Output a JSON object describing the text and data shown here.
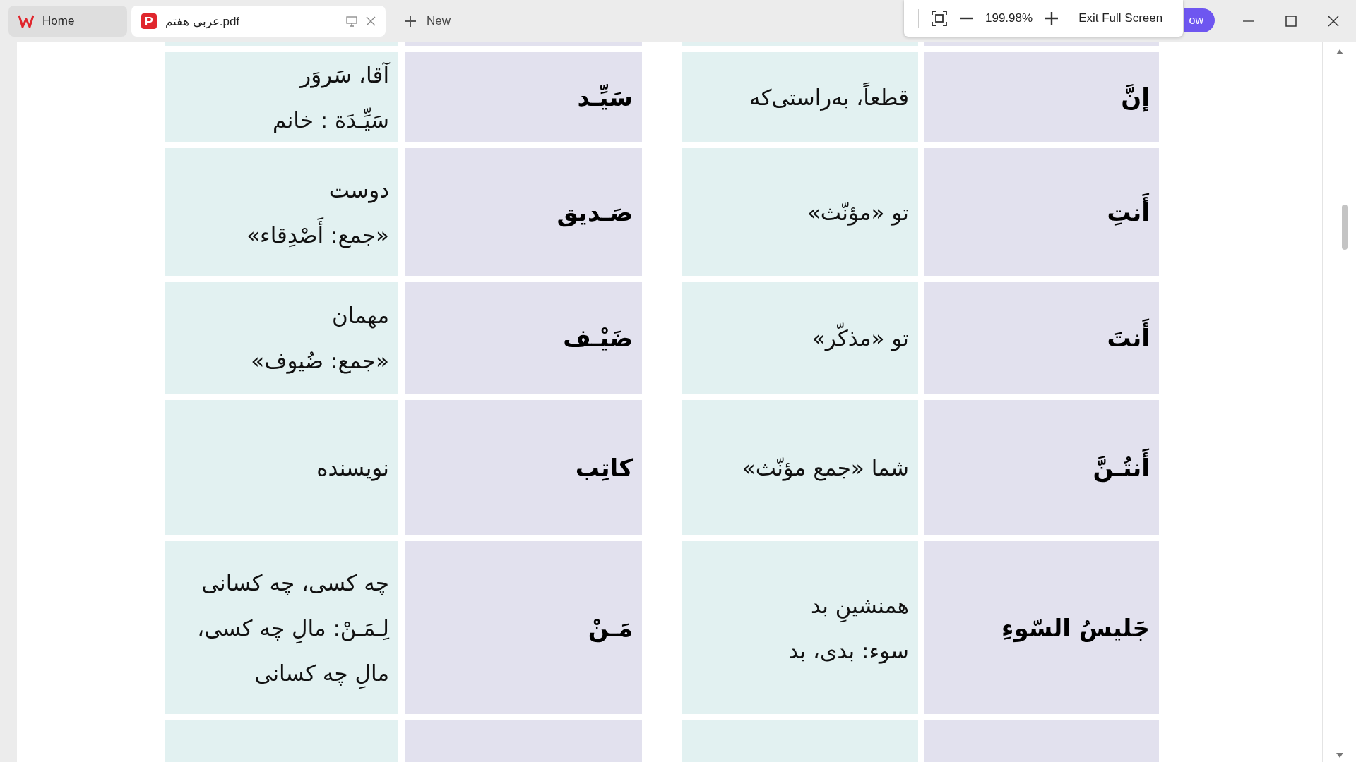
{
  "home_tab": {
    "label": "Home",
    "kind": "home",
    "selected": false
  },
  "document_tab": {
    "label": "عربی هفتم.pdf",
    "kind": "pdf",
    "selected": true
  },
  "new_tab": "New",
  "view_toolbar": {
    "zoom_level": "199.98%",
    "exit_button": "Exit Full Screen"
  },
  "hidden_button": "ow",
  "table": {
    "rows": [
      {
        "kind": "cut"
      },
      {
        "kind": "entry",
        "right": {
          "word": "إنَّ",
          "meaning": [
            "قطعاً، به‌راستی‌که"
          ]
        },
        "left": {
          "word": "سَیِّـد",
          "meaning": [
            "آقا، سَروَر",
            "سَیِّـدَة : خانم"
          ]
        }
      },
      {
        "kind": "entry",
        "right": {
          "word": "أَنتِ",
          "meaning": [
            "تو «مؤنّث»"
          ]
        },
        "left": {
          "word": "صَـدیق",
          "meaning": [
            "دوست",
            "«جمع: أَصْدِقاء»"
          ]
        }
      },
      {
        "kind": "entry",
        "right": {
          "word": "أَنتَ",
          "meaning": [
            "تو «مذکّر»"
          ]
        },
        "left": {
          "word": "ضَیْـف",
          "meaning": [
            "مهمان",
            "«جمع: ضُیوف»"
          ]
        }
      },
      {
        "kind": "entry",
        "right": {
          "word": "أَنتُـنَّ",
          "meaning": [
            "شما «جمع مؤنّث»"
          ]
        },
        "left": {
          "word": "کاتِب",
          "meaning": [
            "نویسنده"
          ]
        }
      },
      {
        "kind": "entry",
        "right": {
          "word": "جَلیسُ السّوءِ",
          "meaning": [
            "همنشینِ بد",
            "سوء: بدی، بد"
          ]
        },
        "left": {
          "word": "مَـنْ",
          "meaning": [
            "چه کسی، چه کسانی",
            "لِـمَـنْ: مالِ چه کسی،",
            "مالِ چه کسانی"
          ]
        }
      },
      {
        "kind": "cut"
      }
    ]
  }
}
